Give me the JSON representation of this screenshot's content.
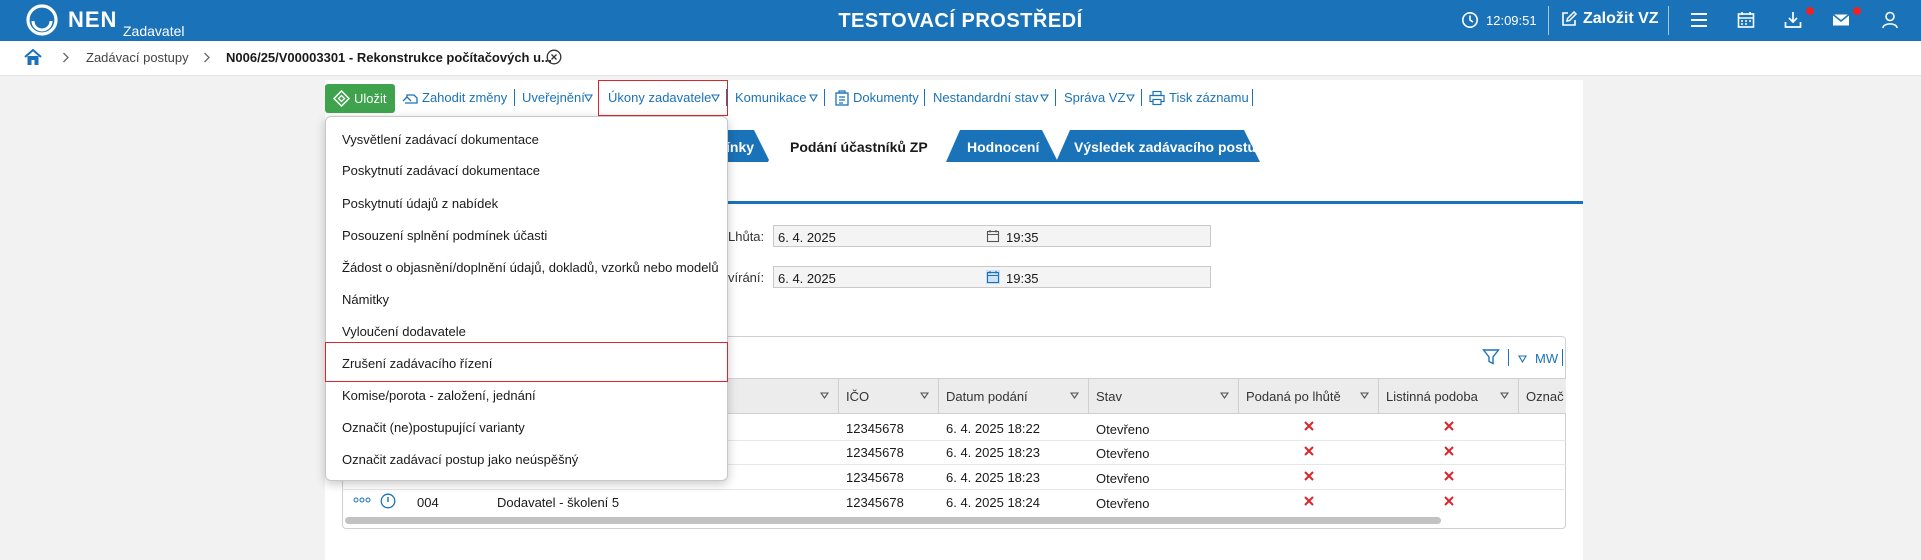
{
  "topbar": {
    "brand": "NEN",
    "brand_sub": "Zadavatel",
    "env_title": "TESTOVACÍ PROSTŘEDÍ",
    "time": "12:09:51",
    "create_label": "Založit VZ",
    "accent": "#1a72b8",
    "icons": [
      "clock-icon",
      "edit-icon",
      "menu-icon",
      "calendar-icon",
      "download-icon",
      "mail-icon",
      "user-icon"
    ]
  },
  "breadcrumb": {
    "item1": "Zadávací postupy",
    "item2": "N006/25/V00003301 - Rekonstrukce počítačových u..."
  },
  "toolbar": {
    "save": "Uložit",
    "discard": "Zahodit změny",
    "publish": "Uveřejnění",
    "actions": "Úkony zadavatele",
    "communication": "Komunikace",
    "documents": "Dokumenty",
    "nonstandard": "Nestandardní stav",
    "admin": "Správa VZ",
    "print": "Tisk záznamu",
    "save_color": "#3fa34d",
    "highlight_color": "#d9262d"
  },
  "tabs": {
    "partial": "ínky",
    "submissions": "Podání účastníků ZP",
    "evaluation": "Hodnocení",
    "result": "Výsledek zadávacího postupu"
  },
  "form": {
    "deadline_label": "Lhůta:",
    "deadline_date": "6. 4. 2025",
    "deadline_time": "19:35",
    "opening_label": "vírání:",
    "opening_date": "6. 4. 2025",
    "opening_time": "19:35"
  },
  "dropdown": {
    "items": [
      "Vysvětlení zadávací dokumentace",
      "Poskytnutí zadávací dokumentace",
      "Poskytnutí údajů z nabídek",
      "Posouzení splnění podmínek účasti",
      "Žádost o objasnění/doplnění údajů, dokladů, vzorků nebo modelů",
      "Námitky",
      "Vyloučení dodavatele",
      "Zrušení zadávacího řízení",
      "Komise/porota - založení, jednání",
      "Označit (ne)postupující varianty",
      "Označit zadávací postup jako neúspěšný"
    ]
  },
  "grid": {
    "mw": "MW",
    "columns": [
      "IČO",
      "Datum podání",
      "Stav",
      "Podaná po lhůtě",
      "Listinná podoba",
      "Označ"
    ],
    "rows": [
      {
        "ico": "12345678",
        "date": "6. 4. 2025 18:22",
        "status": "Otevřeno"
      },
      {
        "ico": "12345678",
        "date": "6. 4. 2025 18:23",
        "status": "Otevřeno"
      },
      {
        "ico": "12345678",
        "date": "6. 4. 2025 18:23",
        "status": "Otevřeno"
      },
      {
        "num": "004",
        "name": "Dodavatel - školení 5",
        "ico": "12345678",
        "date": "6. 4. 2025 18:24",
        "status": "Otevřeno"
      }
    ],
    "cross_color": "#d9262d"
  }
}
